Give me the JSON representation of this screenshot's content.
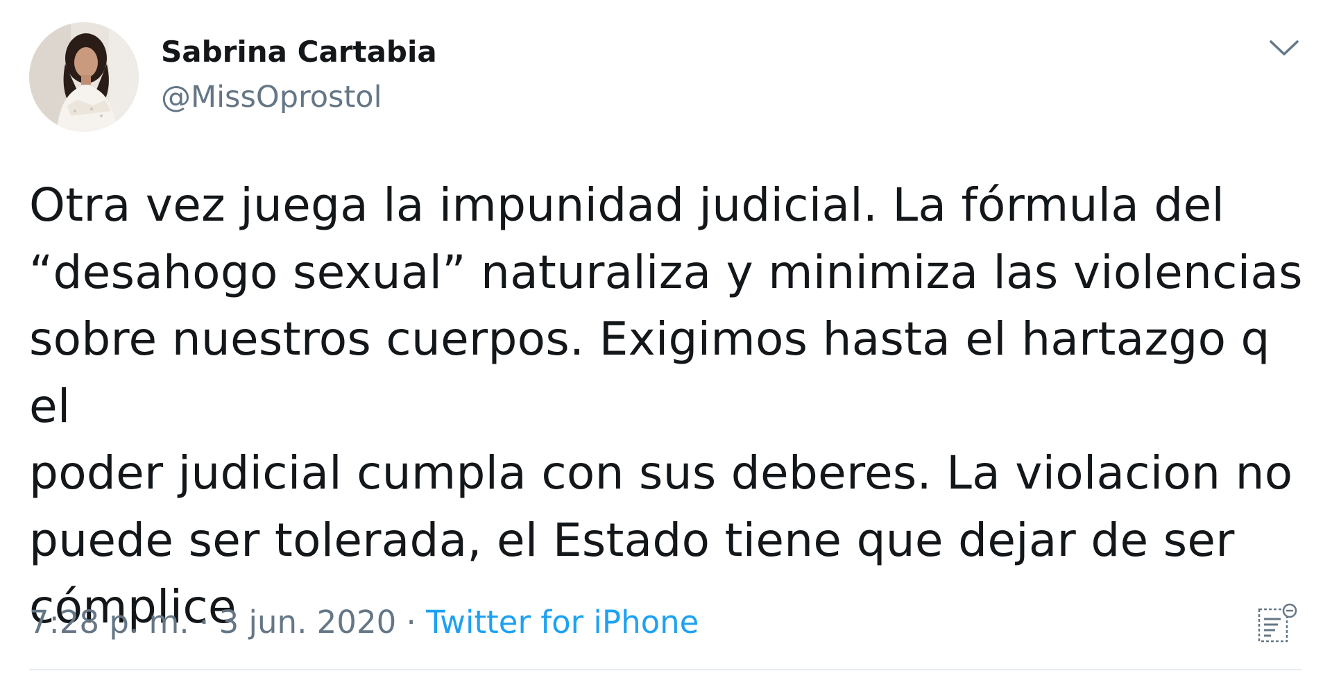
{
  "user": {
    "display_name": "Sabrina Cartabia",
    "handle": "@MissOprostol"
  },
  "tweet": {
    "text": "Otra vez juega la impunidad judicial. La fórmula del\n“desahogo sexual” naturaliza y minimiza las violencias\nsobre nuestros cuerpos. Exigimos hasta el hartazgo q el\npoder judicial cumpla con sus deberes. La violacion no\npuede ser tolerada, el Estado tiene que dejar de ser\ncómplice"
  },
  "meta": {
    "time": "7:28 p. m.",
    "separator": " · ",
    "date": "3 jun. 2020",
    "source": "Twitter for iPhone"
  },
  "icons": {
    "menu": "chevron-down-icon",
    "analytics": "analytics-icon",
    "avatar": "avatar"
  },
  "colors": {
    "text": "#14171a",
    "secondary": "#657786",
    "link": "#1da1f2",
    "divider": "#e6ecf0"
  }
}
